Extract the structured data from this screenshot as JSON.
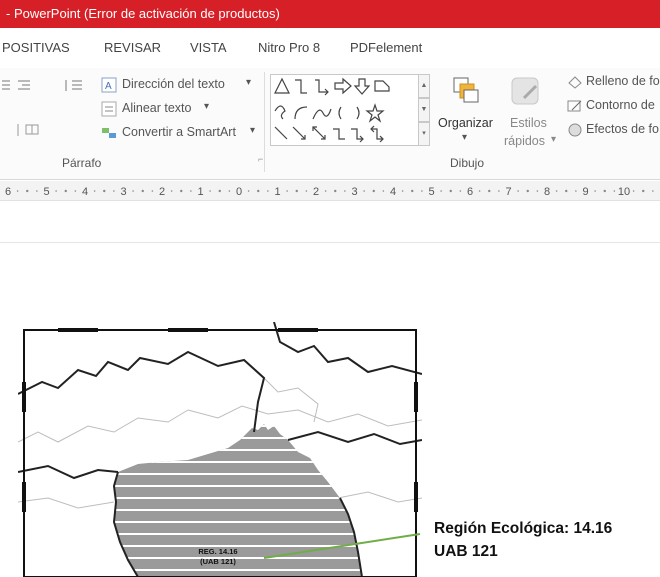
{
  "window": {
    "title": "- PowerPoint (Error de activación de productos)"
  },
  "tabs": [
    "POSITIVAS",
    "REVISAR",
    "VISTA",
    "Nitro Pro 8",
    "PDFelement"
  ],
  "ribbon": {
    "paragraph": {
      "text_direction": "Dirección del texto",
      "align_text": "Alinear texto",
      "convert_smartart": "Convertir a SmartArt",
      "group_label": "Párrafo"
    },
    "drawing": {
      "arrange": "Organizar",
      "quick_styles_line1": "Estilos",
      "quick_styles_line2": "rápidos",
      "shape_fill": "Relleno de fo",
      "shape_outline": "Contorno de",
      "shape_effects": "Efectos de fo",
      "group_label": "Dibujo"
    }
  },
  "ruler": {
    "labels": [
      "6",
      "5",
      "4",
      "3",
      "2",
      "1",
      "0",
      "1",
      "2",
      "3",
      "4",
      "5",
      "6",
      "7",
      "8",
      "9",
      "10"
    ]
  },
  "map": {
    "label_line1": "REG. 14.16",
    "label_line2": "(UAB 121)",
    "hatch_color": "#9a9a9a",
    "arrow_color": "#70ad47"
  },
  "callout": {
    "line1": "Región Ecológica: 14.16",
    "line2": "UAB 121"
  },
  "colors": {
    "titlebar": "#d61f26"
  }
}
